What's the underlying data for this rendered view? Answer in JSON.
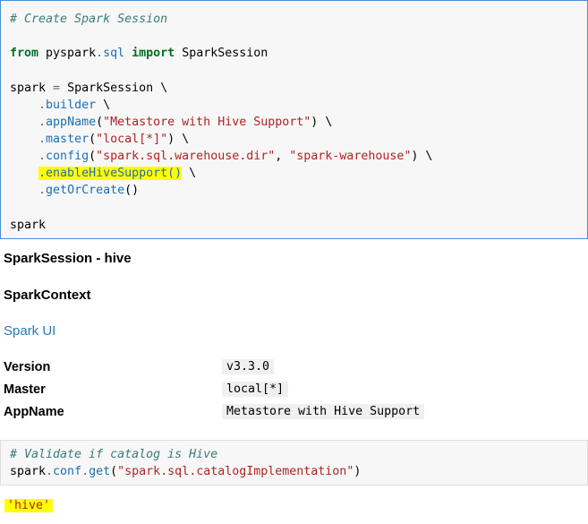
{
  "cell1": {
    "comment": "# Create Spark Session",
    "line_import": {
      "kw_from": "from",
      "module_a": " pyspark",
      "dot": ".",
      "module_b": "sql",
      "kw_import": "import",
      "name": " SparkSession"
    },
    "line_spark": {
      "var": "spark",
      "eq": " = ",
      "cls": "SparkSession \\"
    },
    "line_builder": {
      "dot": ".",
      "attr": "builder",
      "rest": " \\"
    },
    "line_appname": {
      "dot": ".",
      "attr": "appName",
      "open": "(",
      "str": "\"Metastore with Hive Support\"",
      "rest": ") \\"
    },
    "line_master": {
      "dot": ".",
      "attr": "master",
      "open": "(",
      "str": "\"local[*]\"",
      "rest": ") \\"
    },
    "line_config": {
      "dot": ".",
      "attr": "config",
      "open": "(",
      "str1": "\"spark.sql.warehouse.dir\"",
      "sep": ", ",
      "str2": "\"spark-warehouse\"",
      "rest": ") \\"
    },
    "line_hive": {
      "highlighted": ".enableHiveSupport()",
      "rest": " \\"
    },
    "line_getorcreate": {
      "dot": ".",
      "attr": "getOrCreate",
      "rest": "()"
    },
    "line_spark_out": "spark"
  },
  "output1": {
    "session_title": "SparkSession - hive",
    "context_title": "SparkContext",
    "spark_ui_link": "Spark UI",
    "info": [
      {
        "label": "Version",
        "value": "v3.3.0"
      },
      {
        "label": "Master",
        "value": "local[*]"
      },
      {
        "label": "AppName",
        "value": "Metastore with Hive Support"
      }
    ]
  },
  "cell2": {
    "comment": "# Validate if catalog is Hive",
    "line_get": {
      "obj": "spark",
      "dot1": ".",
      "conf": "conf",
      "dot2": ".",
      "get": "get",
      "open": "(",
      "str": "\"spark.sql.catalogImplementation\"",
      "close": ")"
    }
  },
  "output2": {
    "result": "'hive'"
  }
}
